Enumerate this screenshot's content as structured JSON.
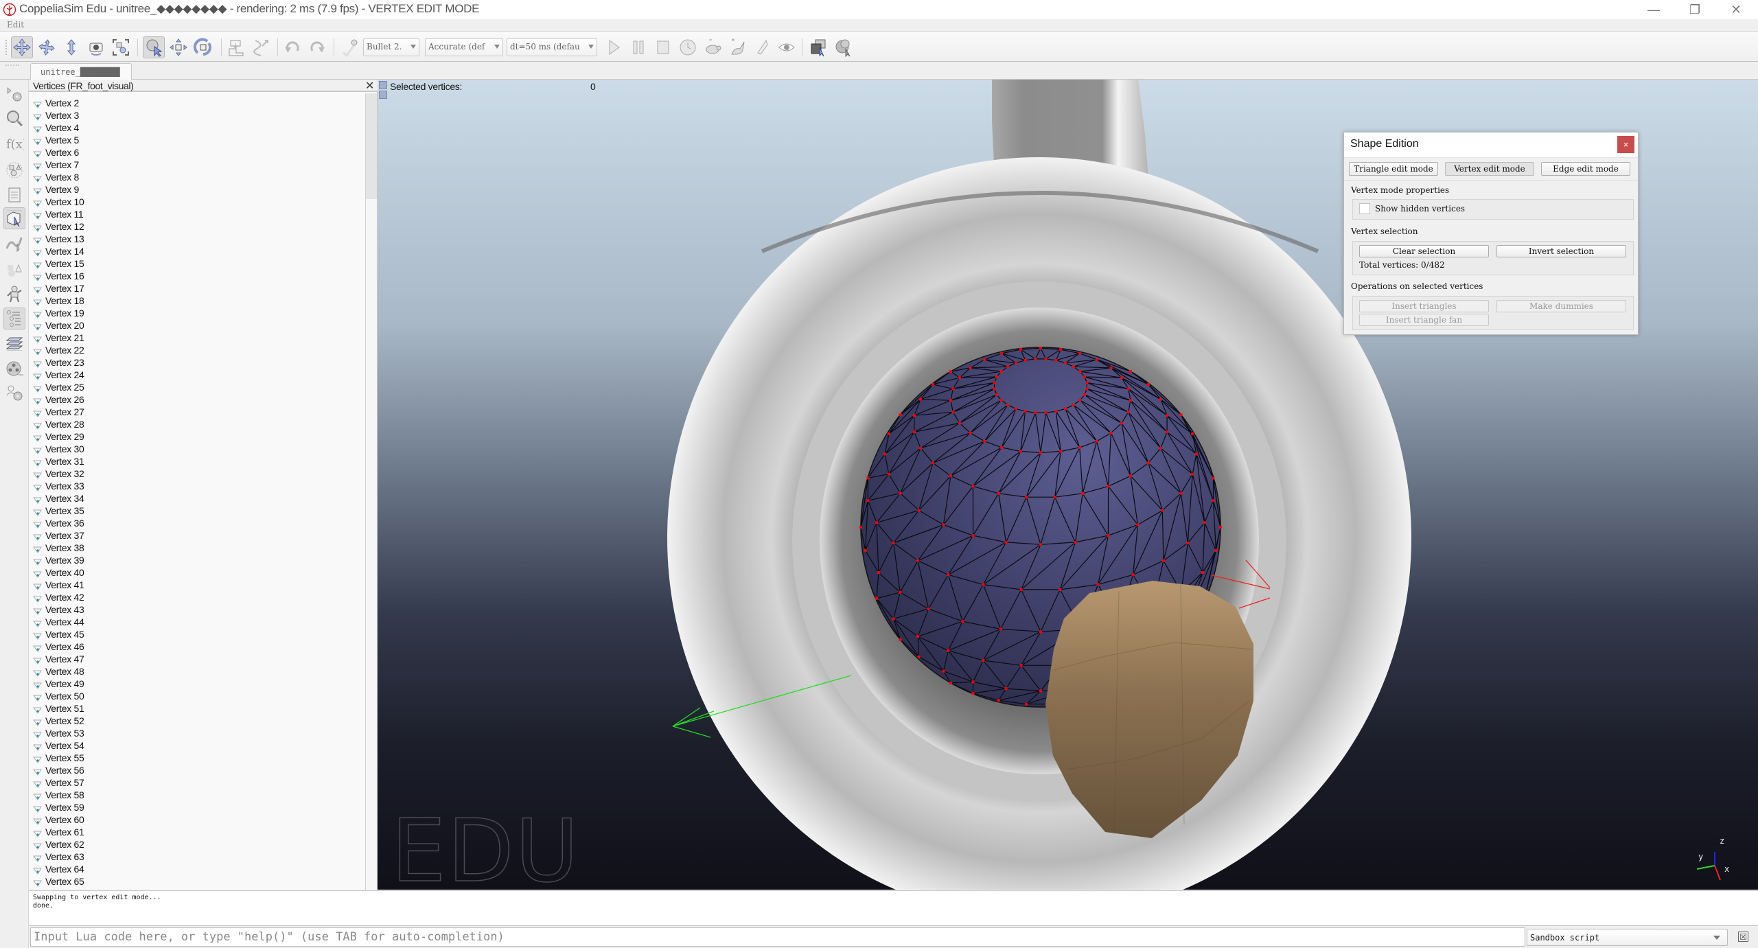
{
  "window": {
    "title": "CoppeliaSim Edu - unitree_◆◆◆◆◆◆◆◆ - rendering: 2 ms (7.9 fps) - VERTEX EDIT MODE",
    "controls": {
      "minimize": "—",
      "restore": "❐",
      "close": "✕"
    }
  },
  "menu": {
    "items": [
      "Edit"
    ]
  },
  "toolbar": {
    "icons": [
      "camera-pan-icon",
      "camera-rotate-icon",
      "camera-shift-icon",
      "camera-angle-icon",
      "fit-to-view-icon",
      "click-selection-icon",
      "object-shift-icon",
      "object-rotate-icon",
      "assemble-icon",
      "transfer-dna-icon",
      "undo-icon",
      "redo-icon",
      "dynamics-toggle-icon"
    ],
    "engine_combo": "Bullet 2.",
    "accuracy_combo": "Accurate (def",
    "timestep_combo": "dt=50 ms (defau",
    "sim_icons": [
      "play-icon",
      "pause-icon",
      "stop-icon",
      "realtime-icon",
      "slower-icon",
      "faster-icon",
      "threaded-rendering-icon",
      "visualization-toggle-icon",
      "page-selector-icon",
      "scene-selector-icon"
    ]
  },
  "tabs": [
    {
      "label": "unitree_████████"
    }
  ],
  "sidebar": {
    "items": [
      "simulation-settings-icon",
      "model-browser-icon",
      "scripts-icon",
      "shape-edit-icon",
      "file-icon",
      "vertex-edit-icon",
      "path-edit-icon",
      "primitives-icon",
      "robot-icon",
      "scene-hierarchy-icon",
      "layers-icon",
      "video-recorder-icon",
      "user-settings-icon"
    ]
  },
  "vertex_list": {
    "header": "Vertices (FR_foot_visual)",
    "close": "✕",
    "items": [
      "Vertex 2",
      "Vertex 3",
      "Vertex 4",
      "Vertex 5",
      "Vertex 6",
      "Vertex 7",
      "Vertex 8",
      "Vertex 9",
      "Vertex 10",
      "Vertex 11",
      "Vertex 12",
      "Vertex 13",
      "Vertex 14",
      "Vertex 15",
      "Vertex 16",
      "Vertex 17",
      "Vertex 18",
      "Vertex 19",
      "Vertex 20",
      "Vertex 21",
      "Vertex 22",
      "Vertex 23",
      "Vertex 24",
      "Vertex 25",
      "Vertex 26",
      "Vertex 27",
      "Vertex 28",
      "Vertex 29",
      "Vertex 30",
      "Vertex 31",
      "Vertex 32",
      "Vertex 33",
      "Vertex 34",
      "Vertex 35",
      "Vertex 36",
      "Vertex 37",
      "Vertex 38",
      "Vertex 39",
      "Vertex 40",
      "Vertex 41",
      "Vertex 42",
      "Vertex 43",
      "Vertex 44",
      "Vertex 45",
      "Vertex 46",
      "Vertex 47",
      "Vertex 48",
      "Vertex 49",
      "Vertex 50",
      "Vertex 51",
      "Vertex 52",
      "Vertex 53",
      "Vertex 54",
      "Vertex 55",
      "Vertex 56",
      "Vertex 57",
      "Vertex 58",
      "Vertex 59",
      "Vertex 60",
      "Vertex 61",
      "Vertex 62",
      "Vertex 63",
      "Vertex 64",
      "Vertex 65"
    ]
  },
  "viewport": {
    "selected_label": "Selected vertices:",
    "selected_count": "0",
    "watermark": "EDU",
    "axes": {
      "x": "x",
      "y": "y",
      "z": "z"
    },
    "colors": {
      "sphere": "#4a4b7a",
      "vertex_marker": "#ff0000",
      "torus": "#b8b8b8",
      "foot": "#8a7050"
    }
  },
  "shape_edition": {
    "title": "Shape Edition",
    "close": "×",
    "modes": [
      "Triangle edit mode",
      "Vertex edit mode",
      "Edge edit mode"
    ],
    "active_mode": "Vertex edit mode",
    "props_label": "Vertex mode properties",
    "show_hidden_label": "Show hidden vertices",
    "show_hidden_checked": false,
    "selection_label": "Vertex selection",
    "clear_selection": "Clear selection",
    "invert_selection": "Invert selection",
    "total_vertices": "Total vertices: 0/482",
    "ops_label": "Operations on selected vertices",
    "insert_triangles": "Insert triangles",
    "make_dummies": "Make dummies",
    "insert_triangle_fan": "Insert triangle fan"
  },
  "console": {
    "lines": [
      "Swapping to vertex edit mode...",
      "done."
    ],
    "input_placeholder": "Input Lua code here, or type \"help()\" (use TAB for auto-completion)",
    "script_selector": "Sandbox script",
    "clear_icon": "☒"
  }
}
